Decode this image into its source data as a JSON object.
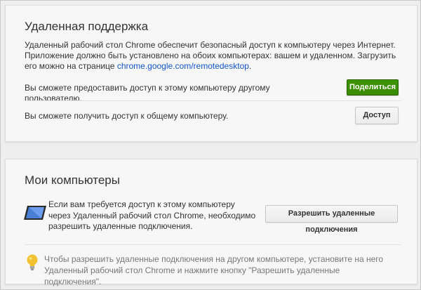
{
  "remote_support": {
    "title": "Удаленная поддержка",
    "description_text": "Удаленный рабочий стол Chrome обеспечит безопасный доступ к компьютеру через Интернет. Приложение должно быть установлено на обоих компьютерах: вашем и удаленном. Загрузить его можно на странице ",
    "description_link": "chrome.google.com/remotedesktop",
    "description_end": ".",
    "share_text": "Вы сможете предоставить доступ к этому компьютеру другому пользователю.",
    "share_button": "Поделиться",
    "access_text": "Вы сможете получить доступ к общему компьютеру.",
    "access_button": "Доступ"
  },
  "my_computers": {
    "title": "Мои компьютеры",
    "info_text": "Если вам требуется доступ к этому компьютеру через Удаленный рабочий стол Chrome, необходимо разрешить удаленные подключения.",
    "enable_button": "Разрешить удаленные подключения",
    "tip_text": "Чтобы разрешить удаленные подключения на другом компьютере, установите на него Удаленный рабочий стол Chrome и нажмите кнопку \"Разрешить удаленные подключения\".",
    "icons": {
      "computer": "monitor-icon",
      "tip": "lightbulb-icon"
    }
  },
  "colors": {
    "primary_button": "#3d9400",
    "link": "#1155cc"
  }
}
